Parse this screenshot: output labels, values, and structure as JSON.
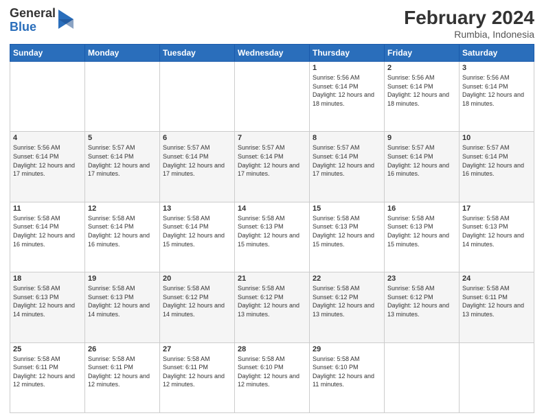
{
  "logo": {
    "general": "General",
    "blue": "Blue"
  },
  "title": {
    "month_year": "February 2024",
    "location": "Rumbia, Indonesia"
  },
  "weekdays": [
    "Sunday",
    "Monday",
    "Tuesday",
    "Wednesday",
    "Thursday",
    "Friday",
    "Saturday"
  ],
  "weeks": [
    [
      {
        "day": "",
        "info": ""
      },
      {
        "day": "",
        "info": ""
      },
      {
        "day": "",
        "info": ""
      },
      {
        "day": "",
        "info": ""
      },
      {
        "day": "1",
        "info": "Sunrise: 5:56 AM\nSunset: 6:14 PM\nDaylight: 12 hours and 18 minutes."
      },
      {
        "day": "2",
        "info": "Sunrise: 5:56 AM\nSunset: 6:14 PM\nDaylight: 12 hours and 18 minutes."
      },
      {
        "day": "3",
        "info": "Sunrise: 5:56 AM\nSunset: 6:14 PM\nDaylight: 12 hours and 18 minutes."
      }
    ],
    [
      {
        "day": "4",
        "info": "Sunrise: 5:56 AM\nSunset: 6:14 PM\nDaylight: 12 hours and 17 minutes."
      },
      {
        "day": "5",
        "info": "Sunrise: 5:57 AM\nSunset: 6:14 PM\nDaylight: 12 hours and 17 minutes."
      },
      {
        "day": "6",
        "info": "Sunrise: 5:57 AM\nSunset: 6:14 PM\nDaylight: 12 hours and 17 minutes."
      },
      {
        "day": "7",
        "info": "Sunrise: 5:57 AM\nSunset: 6:14 PM\nDaylight: 12 hours and 17 minutes."
      },
      {
        "day": "8",
        "info": "Sunrise: 5:57 AM\nSunset: 6:14 PM\nDaylight: 12 hours and 17 minutes."
      },
      {
        "day": "9",
        "info": "Sunrise: 5:57 AM\nSunset: 6:14 PM\nDaylight: 12 hours and 16 minutes."
      },
      {
        "day": "10",
        "info": "Sunrise: 5:57 AM\nSunset: 6:14 PM\nDaylight: 12 hours and 16 minutes."
      }
    ],
    [
      {
        "day": "11",
        "info": "Sunrise: 5:58 AM\nSunset: 6:14 PM\nDaylight: 12 hours and 16 minutes."
      },
      {
        "day": "12",
        "info": "Sunrise: 5:58 AM\nSunset: 6:14 PM\nDaylight: 12 hours and 16 minutes."
      },
      {
        "day": "13",
        "info": "Sunrise: 5:58 AM\nSunset: 6:14 PM\nDaylight: 12 hours and 15 minutes."
      },
      {
        "day": "14",
        "info": "Sunrise: 5:58 AM\nSunset: 6:13 PM\nDaylight: 12 hours and 15 minutes."
      },
      {
        "day": "15",
        "info": "Sunrise: 5:58 AM\nSunset: 6:13 PM\nDaylight: 12 hours and 15 minutes."
      },
      {
        "day": "16",
        "info": "Sunrise: 5:58 AM\nSunset: 6:13 PM\nDaylight: 12 hours and 15 minutes."
      },
      {
        "day": "17",
        "info": "Sunrise: 5:58 AM\nSunset: 6:13 PM\nDaylight: 12 hours and 14 minutes."
      }
    ],
    [
      {
        "day": "18",
        "info": "Sunrise: 5:58 AM\nSunset: 6:13 PM\nDaylight: 12 hours and 14 minutes."
      },
      {
        "day": "19",
        "info": "Sunrise: 5:58 AM\nSunset: 6:13 PM\nDaylight: 12 hours and 14 minutes."
      },
      {
        "day": "20",
        "info": "Sunrise: 5:58 AM\nSunset: 6:12 PM\nDaylight: 12 hours and 14 minutes."
      },
      {
        "day": "21",
        "info": "Sunrise: 5:58 AM\nSunset: 6:12 PM\nDaylight: 12 hours and 13 minutes."
      },
      {
        "day": "22",
        "info": "Sunrise: 5:58 AM\nSunset: 6:12 PM\nDaylight: 12 hours and 13 minutes."
      },
      {
        "day": "23",
        "info": "Sunrise: 5:58 AM\nSunset: 6:12 PM\nDaylight: 12 hours and 13 minutes."
      },
      {
        "day": "24",
        "info": "Sunrise: 5:58 AM\nSunset: 6:11 PM\nDaylight: 12 hours and 13 minutes."
      }
    ],
    [
      {
        "day": "25",
        "info": "Sunrise: 5:58 AM\nSunset: 6:11 PM\nDaylight: 12 hours and 12 minutes."
      },
      {
        "day": "26",
        "info": "Sunrise: 5:58 AM\nSunset: 6:11 PM\nDaylight: 12 hours and 12 minutes."
      },
      {
        "day": "27",
        "info": "Sunrise: 5:58 AM\nSunset: 6:11 PM\nDaylight: 12 hours and 12 minutes."
      },
      {
        "day": "28",
        "info": "Sunrise: 5:58 AM\nSunset: 6:10 PM\nDaylight: 12 hours and 12 minutes."
      },
      {
        "day": "29",
        "info": "Sunrise: 5:58 AM\nSunset: 6:10 PM\nDaylight: 12 hours and 11 minutes."
      },
      {
        "day": "",
        "info": ""
      },
      {
        "day": "",
        "info": ""
      }
    ]
  ]
}
